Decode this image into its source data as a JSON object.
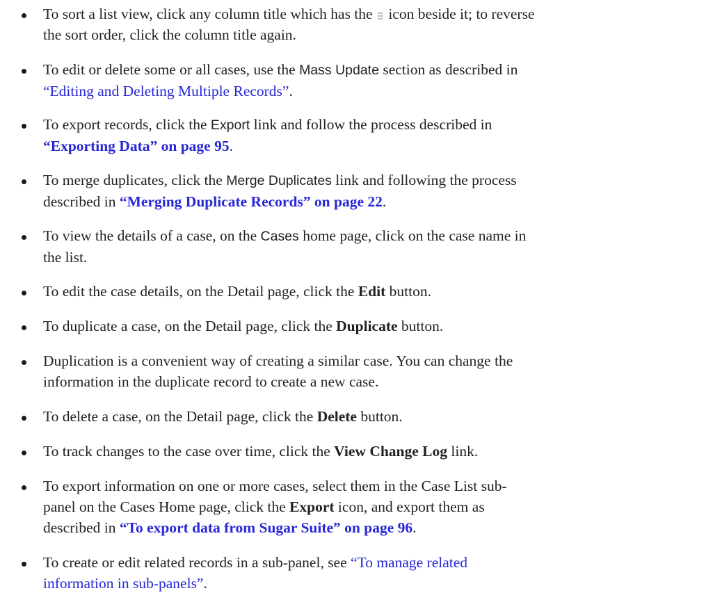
{
  "items": [
    {
      "l1a": "To sort a list view, click any column title which has the",
      "icon": "sort-icon",
      "l1b": "icon beside it; to reverse",
      "l2": "the sort order, click the column title again."
    },
    {
      "l1a": "To edit or delete some or all cases, use the",
      "ui": "Mass Update",
      "l1b": "section as described in",
      "link": "“Editing and Deleting Multiple Records”",
      "end": "."
    },
    {
      "l1a": "To export records, click the",
      "ui": "Export",
      "l1b": "link and follow the process described in",
      "xref": "“Exporting Data” on page 95",
      "end": "."
    },
    {
      "l1a": "To merge duplicates, click the",
      "ui": "Merge Duplicates",
      "l1b": "link and following the process",
      "l2": "described in",
      "xref": "“Merging Duplicate Records” on page 22",
      "end": "."
    },
    {
      "l1a": "To view the details of a case, on the",
      "ui": "Cases",
      "l1b": "home page, click on the case name in",
      "l2": "the list."
    },
    {
      "l1a": "To edit the case details, on the Detail page, click the",
      "bold": "Edit",
      "l1b": "button."
    },
    {
      "l1a": "To duplicate a case, on the Detail page, click the",
      "bold": "Duplicate",
      "l1b": "button."
    },
    {
      "l1a": "Duplication is a convenient way of creating a similar case. You can change the",
      "l2": "information in the duplicate record to create a new case."
    },
    {
      "l1a": "To delete a case, on the Detail page, click the",
      "bold": "Delete",
      "l1b": "button."
    },
    {
      "l1a": "To track changes to the case over time, click the",
      "bold": "View Change Log",
      "l1b": "link."
    },
    {
      "l1a": "To export information on one or more cases, select them in the Case List sub-",
      "l2a": "panel on the Cases Home page, click the",
      "bold": "Export",
      "l2b": "icon, and export them as",
      "l3": "described in",
      "xref": "“To export data from Sugar Suite” on page 96",
      "end": "."
    },
    {
      "l1a": "To create or edit related records in a sub-panel, see",
      "link_l1": "“To manage related",
      "link_l2": "information in sub-panels”",
      "end": "."
    }
  ],
  "colors": {
    "link": "#2727d6",
    "text": "#222222"
  }
}
